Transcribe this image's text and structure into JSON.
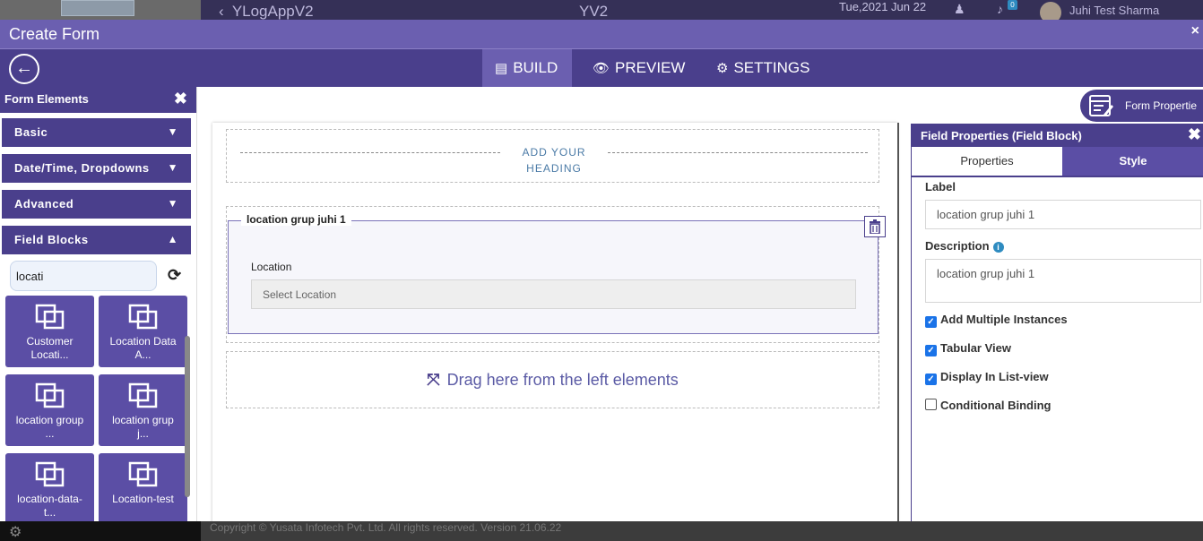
{
  "background": {
    "app_title": "YLogAppV2",
    "center_title": "YV2",
    "date": "Tue,2021 Jun 22",
    "notification_count": "0",
    "user_name": "Juhi Test Sharma",
    "footer_text": "Copyright © Yusata Infotech Pvt. Ltd. All rights reserved.   Version 21.06.22"
  },
  "modal": {
    "title": "Create Form",
    "close": "×"
  },
  "tabs": [
    {
      "label": "BUILD",
      "icon": "form-icon",
      "active": true
    },
    {
      "label": "PREVIEW",
      "icon": "eye-icon",
      "active": false
    },
    {
      "label": "SETTINGS",
      "icon": "gear-icon",
      "active": false
    }
  ],
  "left_panel": {
    "title": "Form Elements",
    "sections": [
      {
        "label": "Basic",
        "expanded": false
      },
      {
        "label": "Date/Time, Dropdowns",
        "expanded": false
      },
      {
        "label": "Advanced",
        "expanded": false
      },
      {
        "label": "Field Blocks",
        "expanded": true
      }
    ],
    "search_value": "locati",
    "tiles": [
      {
        "label1": "Customer",
        "label2": "Locati..."
      },
      {
        "label1": "Location Data",
        "label2": "A..."
      },
      {
        "label1": "location group",
        "label2": "..."
      },
      {
        "label1": "location grup",
        "label2": "j..."
      },
      {
        "label1": "location-data-",
        "label2": "t..."
      },
      {
        "label1": "Location-test",
        "label2": ""
      }
    ]
  },
  "canvas": {
    "heading_placeholder_line1": "ADD YOUR",
    "heading_placeholder_line2": "HEADING",
    "block_legend": "location grup juhi 1",
    "field_label": "Location",
    "field_placeholder": "Select Location",
    "drop_text": "Drag here from the left elements",
    "form_properties": "Form Propertie"
  },
  "right_panel": {
    "title": "Field Properties (Field Block)",
    "tab_properties": "Properties",
    "tab_style": "Style",
    "label_caption": "Label",
    "label_value": "location grup juhi 1",
    "description_caption": "Description",
    "description_value": "location grup juhi 1",
    "checkboxes": [
      {
        "label": "Add Multiple Instances",
        "checked": true
      },
      {
        "label": "Tabular View",
        "checked": true
      },
      {
        "label": "Display In List-view",
        "checked": true
      },
      {
        "label": "Conditional Binding",
        "checked": false
      }
    ]
  },
  "colors": {
    "primary": "#4a3f8c",
    "header": "#6b5fb0",
    "tile": "#5b4ea5",
    "link": "#4a7aa6",
    "checkbox": "#1a73e8"
  }
}
